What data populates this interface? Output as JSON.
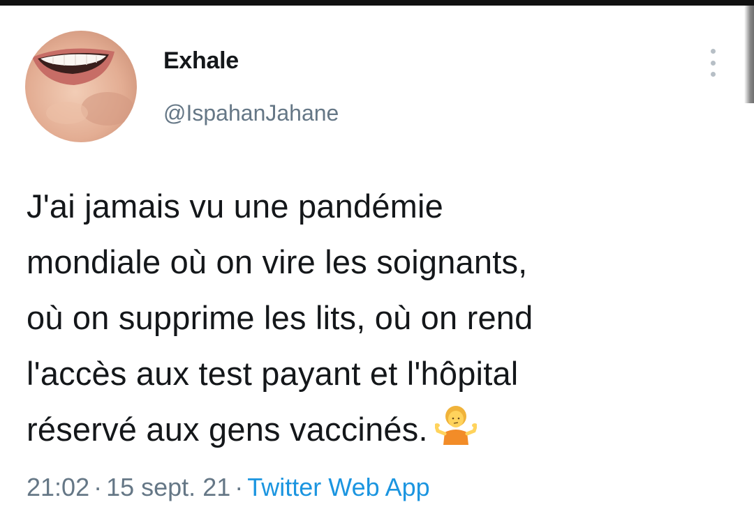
{
  "tweet": {
    "display_name": "Exhale",
    "handle": "@IspahanJahane",
    "text_lines": [
      "J'ai jamais vu une pandémie",
      "mondiale où on vire les soignants,",
      "où on supprime les lits, où on rend",
      "l'accès aux test payant et l'hôpital",
      "réservé aux gens vaccinés."
    ],
    "emoji_icon": "person-shrugging-emoji-icon",
    "time": "21:02",
    "separator": "·",
    "date": "15 sept. 21",
    "source": "Twitter Web App"
  },
  "colors": {
    "text": "#14171a",
    "secondary": "#657786",
    "link": "#1b95e0",
    "top_bar": "#111111"
  },
  "icons": {
    "more": "more-vertical-icon",
    "avatar": "avatar-smile-photo"
  }
}
